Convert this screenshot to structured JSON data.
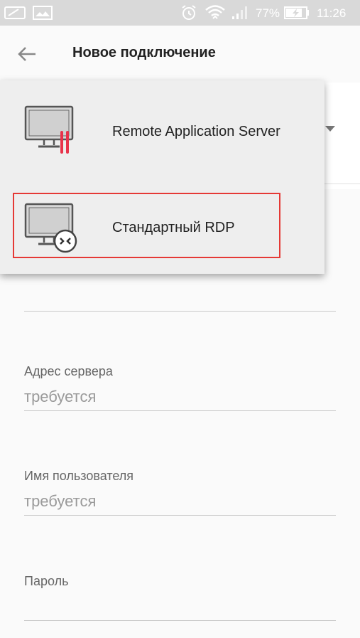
{
  "status_bar": {
    "battery_percent": "77%",
    "time": "11:26",
    "icons": [
      "notification-icon",
      "gallery-icon",
      "alarm-icon",
      "wifi-icon",
      "signal-icon",
      "battery-charging-icon"
    ]
  },
  "toolbar": {
    "back_icon": "arrow-left-icon",
    "title": "Новое подключение"
  },
  "dropdown": {
    "options": [
      {
        "label": "Remote Application Server",
        "icon": "monitor-ras-icon"
      },
      {
        "label": "Стандартный RDP",
        "icon": "monitor-rdp-icon"
      }
    ],
    "highlighted_index": 1,
    "highlight_color": "#e53935"
  },
  "form": {
    "server_address": {
      "label": "Адрес сервера",
      "placeholder": "требуется"
    },
    "username": {
      "label": "Имя пользователя",
      "placeholder": "требуется"
    },
    "password": {
      "label": "Пароль",
      "placeholder": ""
    }
  },
  "colors": {
    "status_bar_bg": "#d9d9d9",
    "accent_red": "#e53935",
    "ras_bar_color": "#e8334a"
  }
}
